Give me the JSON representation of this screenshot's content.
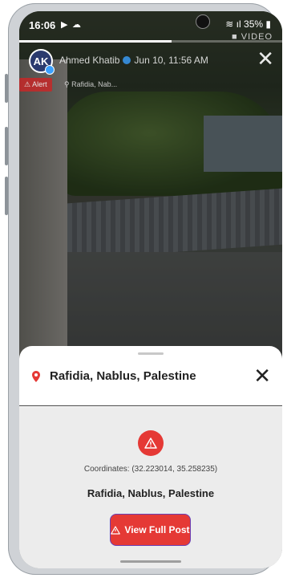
{
  "status_bar": {
    "time": "16:06",
    "icons_left": [
      "youtube-icon",
      "cloud-icon"
    ],
    "right": "35%"
  },
  "video_label": "VIDEO",
  "progress": 0.58,
  "post": {
    "avatar_initials": "AK",
    "author": "Ahmed Khatib",
    "date": "Jun 10, 11:56 AM",
    "tag_alert": "Alert",
    "tag_location": "Rafidia, Nab..."
  },
  "sheet": {
    "title": "Rafidia, Nablus, Palestine",
    "coordinates": "Coordinates: (32.223014, 35.258235)",
    "place": "Rafidia, Nablus, Palestine",
    "button_label": "View Full Post"
  },
  "colors": {
    "accent_red": "#e53935",
    "button_border": "#6a3fb5",
    "sheet_body_bg": "#ececec"
  }
}
